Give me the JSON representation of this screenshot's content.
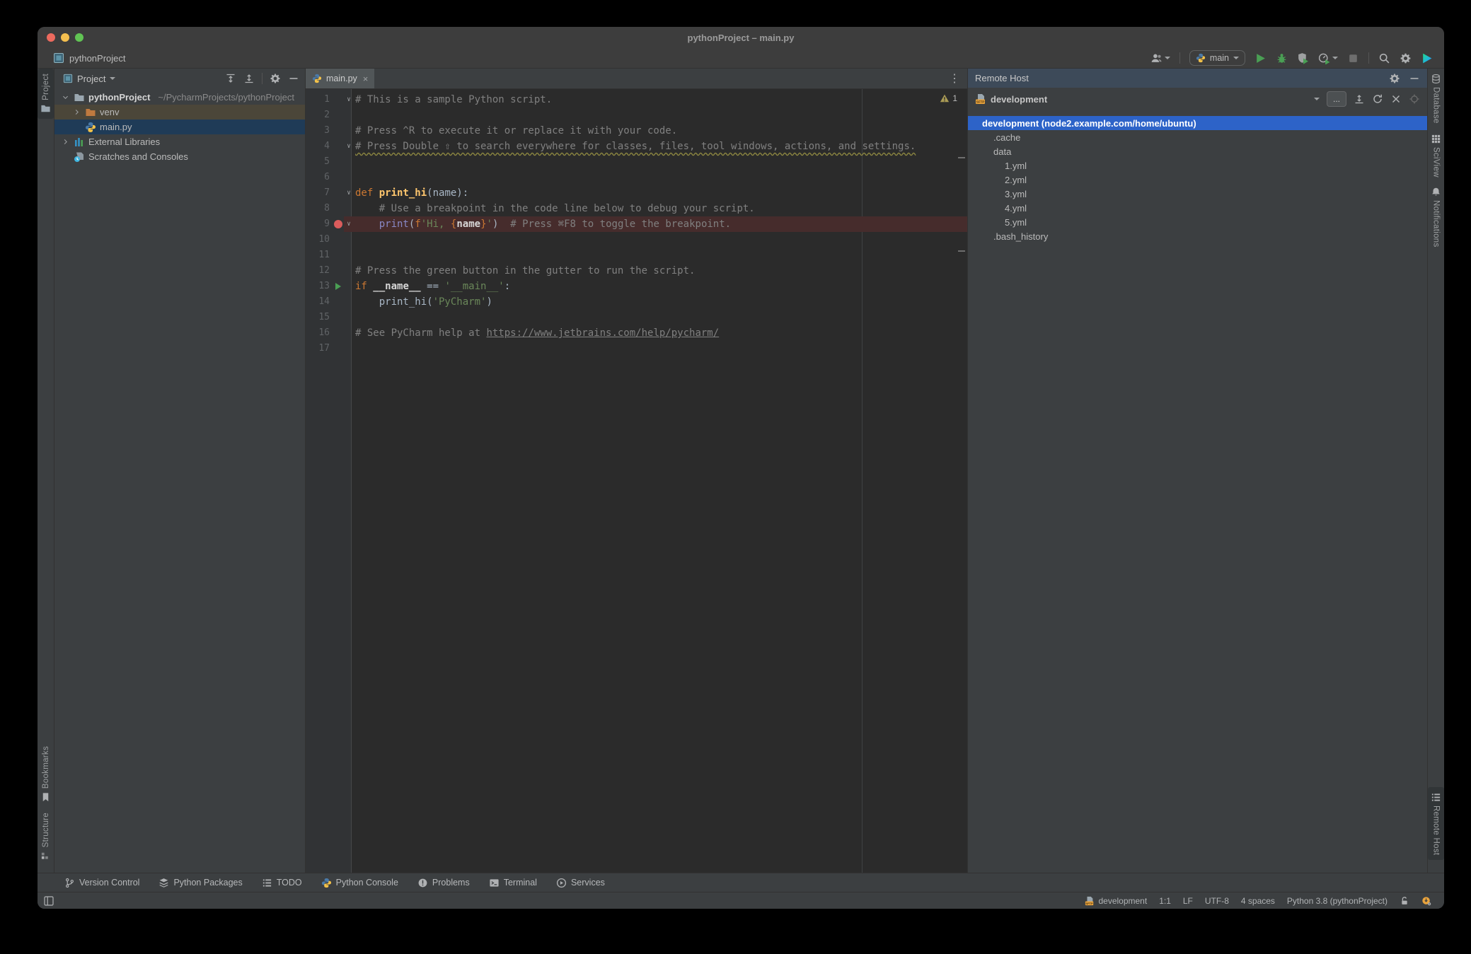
{
  "window": {
    "title": "pythonProject – main.py"
  },
  "toolbar": {
    "project_name": "pythonProject",
    "run_config": "main"
  },
  "left_strip": {
    "top": [
      {
        "label": "Project",
        "icon": "folder",
        "active": true
      }
    ],
    "bottom": [
      {
        "label": "Bookmarks",
        "icon": "bookmark"
      },
      {
        "label": "Structure",
        "icon": "structure"
      }
    ]
  },
  "right_strip": {
    "top": [
      {
        "label": "Database",
        "icon": "database"
      },
      {
        "label": "SciView",
        "icon": "grid"
      },
      {
        "label": "Notifications",
        "icon": "bell"
      }
    ],
    "bottom": [
      {
        "label": "Remote Host",
        "icon": "remote",
        "active": true
      }
    ]
  },
  "project_panel": {
    "title": "Project",
    "tree": [
      {
        "label": "pythonProject",
        "sub": "~/PycharmProjects/pythonProject",
        "icon": "folder",
        "level": 0,
        "chevron": "down",
        "bold": true
      },
      {
        "label": "venv",
        "icon": "folder-orange",
        "level": 1,
        "chevron": "right",
        "row_bg": "#4b4639"
      },
      {
        "label": "main.py",
        "icon": "python",
        "level": 1,
        "row_bg": "#1f3b57"
      },
      {
        "label": "External Libraries",
        "icon": "libraries",
        "level": 0,
        "chevron": "right"
      },
      {
        "label": "Scratches and Consoles",
        "icon": "scratches",
        "level": 0
      }
    ]
  },
  "editor": {
    "tab": "main.py",
    "warning_count": "1",
    "lines": [
      {
        "n": "1",
        "fold": true,
        "seg": [
          [
            "cmt",
            "# This is a sample Python script."
          ]
        ]
      },
      {
        "n": "2",
        "seg": []
      },
      {
        "n": "3",
        "seg": [
          [
            "cmt",
            "# Press ^R to execute it or replace it with your code."
          ]
        ]
      },
      {
        "n": "4",
        "fold": true,
        "seg": [
          [
            "cmt wavy",
            "# Press Double ⇧ to search everywhere for classes, files, tool windows, actions, and settings."
          ]
        ]
      },
      {
        "n": "5",
        "seg": []
      },
      {
        "n": "6",
        "seg": []
      },
      {
        "n": "7",
        "fold": true,
        "seg": [
          [
            "kw",
            "def "
          ],
          [
            "fn",
            "print_hi"
          ],
          [
            "plain",
            "(name):"
          ]
        ]
      },
      {
        "n": "8",
        "seg": [
          [
            "cmt",
            "    # Use a breakpoint in the code line below to debug your script."
          ]
        ]
      },
      {
        "n": "9",
        "bp": true,
        "hl": true,
        "fold": true,
        "seg": [
          [
            "plain",
            "    "
          ],
          [
            "builtin",
            "print"
          ],
          [
            "plain",
            "("
          ],
          [
            "kw",
            "f"
          ],
          [
            "str",
            "'Hi, "
          ],
          [
            "kw",
            "{"
          ],
          [
            "b",
            "name"
          ],
          [
            "kw",
            "}"
          ],
          [
            "str",
            "'"
          ],
          [
            "plain",
            ")"
          ],
          [
            "cmt",
            "  # Press ⌘F8 to toggle the breakpoint."
          ]
        ]
      },
      {
        "n": "10",
        "seg": []
      },
      {
        "n": "11",
        "seg": []
      },
      {
        "n": "12",
        "seg": [
          [
            "cmt",
            "# Press the green button in the gutter to run the script."
          ]
        ]
      },
      {
        "n": "13",
        "run": true,
        "seg": [
          [
            "kw",
            "if "
          ],
          [
            "b",
            "__name__"
          ],
          [
            "plain",
            " == "
          ],
          [
            "str",
            "'__main__'"
          ],
          [
            "plain",
            ":"
          ]
        ]
      },
      {
        "n": "14",
        "seg": [
          [
            "plain",
            "    print_hi("
          ],
          [
            "str",
            "'PyCharm'"
          ],
          [
            "plain",
            ")"
          ]
        ]
      },
      {
        "n": "15",
        "seg": []
      },
      {
        "n": "16",
        "seg": [
          [
            "cmt",
            "# See PyCharm help at "
          ],
          [
            "link",
            "https://www.jetbrains.com/help/pycharm/"
          ]
        ]
      },
      {
        "n": "17",
        "seg": []
      }
    ]
  },
  "remote_panel": {
    "title": "Remote Host",
    "server": "development",
    "more_label": "...",
    "tree": [
      {
        "label": "development (node2.example.com/home/ubuntu)",
        "icon": "sftp",
        "level": 0,
        "chevron": "down",
        "selected": true
      },
      {
        "label": ".cache",
        "icon": "folder",
        "level": 1,
        "chevron": "right"
      },
      {
        "label": "data",
        "icon": "folder",
        "level": 1,
        "chevron": "down"
      },
      {
        "label": "1.yml",
        "icon": "yml",
        "level": 2
      },
      {
        "label": "2.yml",
        "icon": "yml",
        "level": 2
      },
      {
        "label": "3.yml",
        "icon": "yml",
        "level": 2
      },
      {
        "label": "4.yml",
        "icon": "yml",
        "level": 2
      },
      {
        "label": "5.yml",
        "icon": "yml",
        "level": 2
      },
      {
        "label": ".bash_history",
        "icon": "file-question",
        "level": 1
      }
    ]
  },
  "bottom_bar": {
    "buttons": [
      {
        "label": "Version Control",
        "icon": "git-branch"
      },
      {
        "label": "Python Packages",
        "icon": "packages"
      },
      {
        "label": "TODO",
        "icon": "todo"
      },
      {
        "label": "Python Console",
        "icon": "python"
      },
      {
        "label": "Problems",
        "icon": "problems"
      },
      {
        "label": "Terminal",
        "icon": "terminal"
      },
      {
        "label": "Services",
        "icon": "services"
      }
    ]
  },
  "status_bar": {
    "items": [
      {
        "label": "development",
        "icon": "sftp"
      },
      {
        "label": "1:1"
      },
      {
        "label": "LF"
      },
      {
        "label": "UTF-8"
      },
      {
        "label": "4 spaces"
      },
      {
        "label": "Python 3.8 (pythonProject)"
      },
      {
        "icon": "unlock"
      },
      {
        "icon": "sync"
      }
    ]
  },
  "colors": {
    "selection_blue": "#2d63c8",
    "inactive_selection": "#1f3b57",
    "venv_row": "#4b4639",
    "breakpoint_red": "#db5c5c",
    "breakpoint_line": "#462c2c",
    "run_green": "#4a9f54",
    "sftp_orange": "#e8a33d",
    "yml_red": "#c75450",
    "editor_bg": "#2b2b2b",
    "panel_bg": "#3c3f41"
  }
}
